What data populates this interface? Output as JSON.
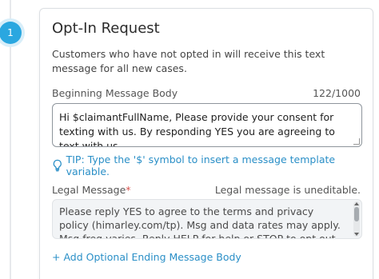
{
  "step": {
    "number": "1"
  },
  "card": {
    "title": "Opt-In Request",
    "description": "Customers who have not opted in will receive this text message for all new cases."
  },
  "beginning_message": {
    "label": "Beginning Message Body",
    "counter": "122/1000",
    "value": "Hi $claimantFullName, Please provide your consent for texting with us. By responding YES you are agreeing to text with us."
  },
  "tip": {
    "icon": "lightbulb-icon",
    "text": "TIP: Type the '$' symbol to insert a message template variable."
  },
  "legal_message": {
    "label": "Legal Message",
    "required_marker": "*",
    "note": "Legal message is uneditable.",
    "value": "Please reply YES to agree to the terms and privacy policy (himarley.com/tp). Msg and data rates may apply. Msg freq varies. Reply HELP for help or STOP to opt out."
  },
  "actions": {
    "add_ending_label": "+ Add Optional Ending Message Body"
  },
  "colors": {
    "accent": "#2aa7e0",
    "link": "#2a8fc7",
    "required": "#d9534f"
  }
}
